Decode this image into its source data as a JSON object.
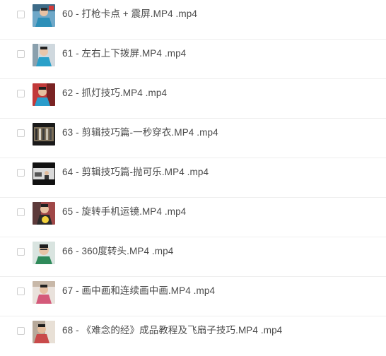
{
  "files": [
    {
      "name": "60 - 打枪卡点 + 震屏.MP4 .mp4",
      "thumb": "person-thumbnail"
    },
    {
      "name": "61 - 左右上下拨屏.MP4 .mp4",
      "thumb": "person-thumbnail"
    },
    {
      "name": "62 - 抓灯技巧.MP4 .mp4",
      "thumb": "person-thumbnail"
    },
    {
      "name": "63 - 剪辑技巧篇-一秒穿衣.MP4 .mp4",
      "thumb": "closet-thumbnail"
    },
    {
      "name": "64 - 剪辑技巧篇-抛可乐.MP4 .mp4",
      "thumb": "scene-thumbnail"
    },
    {
      "name": "65 - 旋转手机运镜.MP4 .mp4",
      "thumb": "person-thumbnail"
    },
    {
      "name": "66 - 360度转头.MP4 .mp4",
      "thumb": "person-thumbnail"
    },
    {
      "name": "67 - 画中画和连续画中画.MP4 .mp4",
      "thumb": "person-thumbnail"
    },
    {
      "name": "68 - 《难念的经》成品教程及飞扇子技巧.MP4 .mp4",
      "thumb": "person-thumbnail"
    }
  ]
}
